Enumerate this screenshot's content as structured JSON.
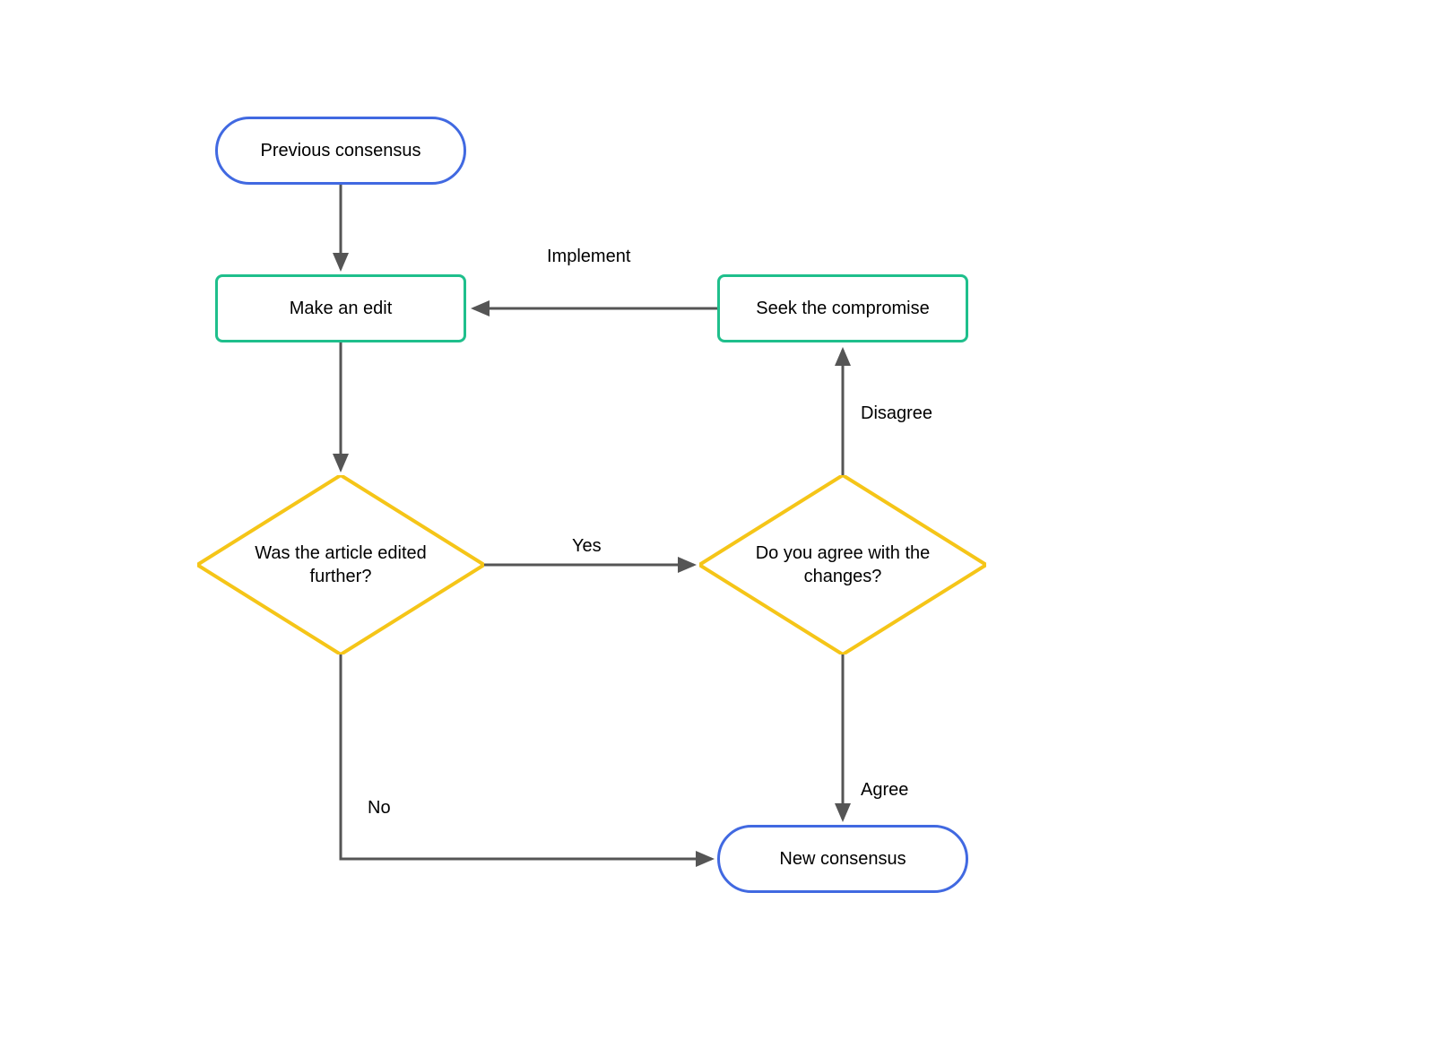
{
  "nodes": {
    "start": {
      "label": "Previous consensus"
    },
    "makeEdit": {
      "label": "Make an edit"
    },
    "seekCompromise": {
      "label": "Seek the compromise"
    },
    "editedFurther": {
      "label": "Was the article edited further?"
    },
    "agreeChanges": {
      "label": "Do you agree with the changes?"
    },
    "end": {
      "label": "New consensus"
    }
  },
  "edges": {
    "implement": "Implement",
    "disagree": "Disagree",
    "yes": "Yes",
    "no": "No",
    "agree": "Agree"
  },
  "colors": {
    "terminator": "#4169E1",
    "process": "#1fbf8c",
    "decision": "#f5c518",
    "arrow": "#555555"
  }
}
